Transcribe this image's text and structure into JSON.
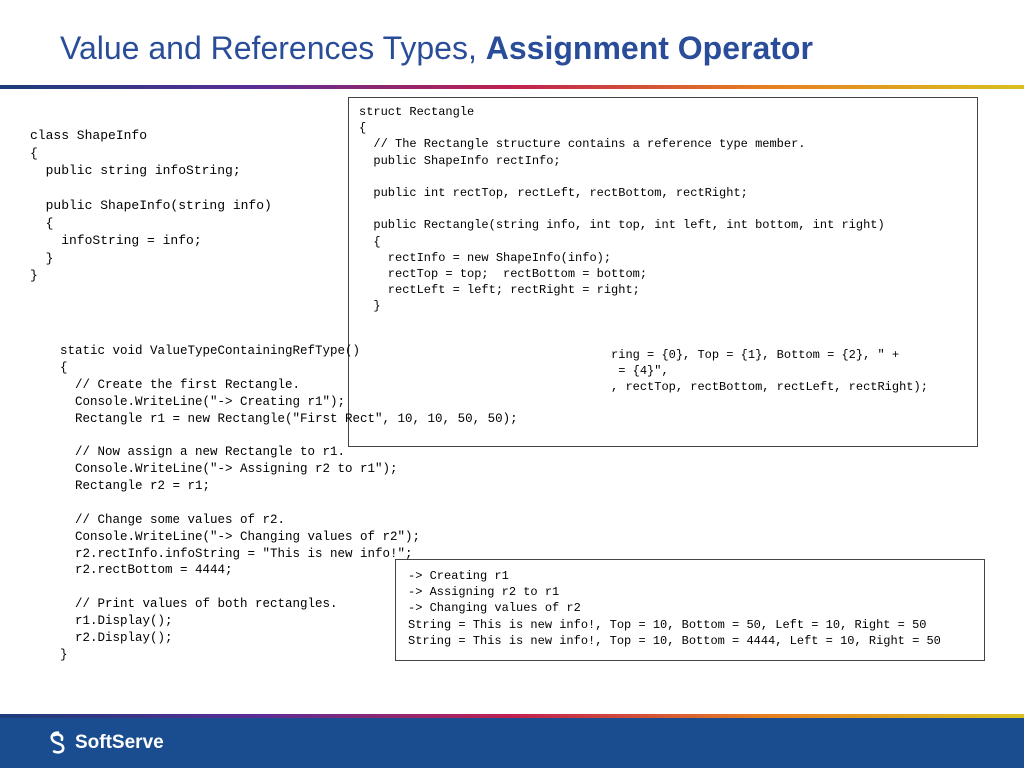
{
  "title": {
    "light": "Value and References Types, ",
    "bold": "Assignment Operator"
  },
  "code": {
    "shapeinfo": "class ShapeInfo\n{\n  public string infoString;\n\n  public ShapeInfo(string info)\n  {\n    infoString = info;\n  }\n}",
    "rectangle": "struct Rectangle\n{\n  // The Rectangle structure contains a reference type member.\n  public ShapeInfo rectInfo;\n\n  public int rectTop, rectLeft, rectBottom, rectRight;\n\n  public Rectangle(string info, int top, int left, int bottom, int right)\n  {\n    rectInfo = new ShapeInfo(info);\n    rectTop = top;  rectBottom = bottom;\n    rectLeft = left; rectRight = right;\n  }\n\n\n                                   ring = {0}, Top = {1}, Bottom = {2}, \" +\n                                    = {4}\",\n                                   , rectTop, rectBottom, rectLeft, rectRight);\n\n",
    "method": "static void ValueTypeContainingRefType()\n{\n  // Create the first Rectangle.\n  Console.WriteLine(\"-> Creating r1\");\n  Rectangle r1 = new Rectangle(\"First Rect\", 10, 10, 50, 50);\n\n  // Now assign a new Rectangle to r1.\n  Console.WriteLine(\"-> Assigning r2 to r1\");\n  Rectangle r2 = r1;\n\n  // Change some values of r2.\n  Console.WriteLine(\"-> Changing values of r2\");\n  r2.rectInfo.infoString = \"This is new info!\";\n  r2.rectBottom = 4444;\n\n  // Print values of both rectangles.\n  r1.Display();\n  r2.Display();\n}",
    "output": "-> Creating r1\n-> Assigning r2 to r1\n-> Changing values of r2\nString = This is new info!, Top = 10, Bottom = 50, Left = 10, Right = 50\nString = This is new info!, Top = 10, Bottom = 4444, Left = 10, Right = 50"
  },
  "footer": {
    "brand": "SoftServe"
  }
}
